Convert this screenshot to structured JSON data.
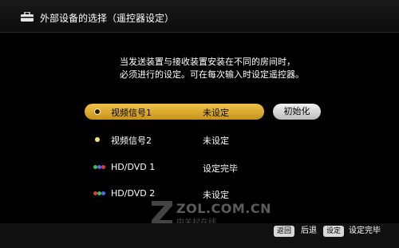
{
  "header": {
    "title": "外部设备的选择（遥控器设定）"
  },
  "description": {
    "line1": "当发送装置与接收装置安装在不同的房间时，",
    "line2": "必须进行的设定。可在每次输入时设定遥控器。"
  },
  "devices": [
    {
      "name": "视频信号1",
      "status": "未设定",
      "selected": true,
      "icon": "yellow-dot-icon"
    },
    {
      "name": "视频信号2",
      "status": "未设定",
      "selected": false,
      "icon": "yellow-dot-icon"
    },
    {
      "name": "HD/DVD 1",
      "status": "设定完毕",
      "selected": false,
      "icon": "rgb-dots-icon"
    },
    {
      "name": "HD/DVD 2",
      "status": "未设定",
      "selected": false,
      "icon": "rgb-dots-icon"
    }
  ],
  "init_button": "初始化",
  "watermark": {
    "domain": "ZOL.COM.CN",
    "sub": "中关村在线"
  },
  "footer": {
    "back_key": "返回",
    "back_label": "后退",
    "set_key": "设定",
    "set_label": "设定完毕"
  },
  "colors": {
    "selected_bar": "#e0ae2e",
    "dot_yellow": "#f3e27a",
    "dot_red": "#e23a3a",
    "dot_green": "#36c24a",
    "dot_blue": "#4a6cff"
  }
}
